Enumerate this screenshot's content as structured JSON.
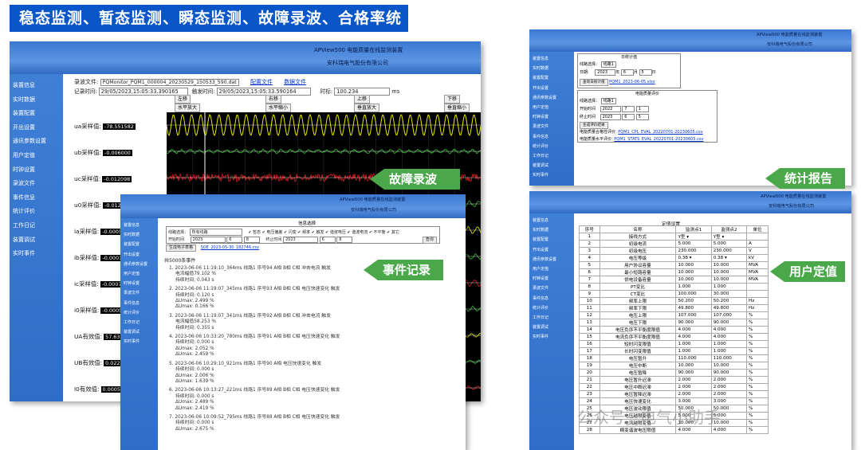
{
  "banner": "稳态监测、暂态监测、瞬态监测、故障录波、合格率统计等",
  "device_title": "APView500 电能质量在线监测装置",
  "company": "安科瑞电气股份有限公司",
  "menu": [
    "装置信息",
    "实时数据",
    "装置配置",
    "开出设置",
    "通讯参数设置",
    "用户定值",
    "时钟设置",
    "录波文件",
    "事件信息",
    "统计评价",
    "工作日记",
    "装置调试",
    "实时事件"
  ],
  "wave": {
    "file_label": "录波文件:",
    "file_value": "PQMonitor_PQM1_000004_20230529_150533_590.dat",
    "config_link": "配置文件",
    "data_link": "数据文件",
    "rec_time_label": "记录时间:",
    "rec_time": "29/05/2023,15:05:33.390165",
    "trig_time_label": "触发时间:",
    "trig_time": "29/05/2023,15:05:33.590164",
    "time_label": "时标:",
    "time_value": "100.234",
    "time_unit": "ms",
    "btn_left": "左移",
    "btn_right": "右移",
    "btn_up": "上移",
    "btn_down": "下移",
    "btn_hzoom_in": "水平放大",
    "btn_hzoom_out": "水平缩小",
    "btn_vzoom_in": "垂直放大",
    "btn_vzoom_out": "垂直缩小",
    "channels": [
      {
        "label": "ua采样值:",
        "value": "-78.551582"
      },
      {
        "label": "ub采样值:",
        "value": "-0.006000"
      },
      {
        "label": "uc采样值:",
        "value": "-0.012098"
      },
      {
        "label": "u0采样值:",
        "value": "-0.0129"
      },
      {
        "label": "ia采样值:",
        "value": "-0.00052"
      },
      {
        "label": "ib采样值:",
        "value": "-0.0001"
      },
      {
        "label": "ic采样值:",
        "value": "-0.00071"
      },
      {
        "label": "i0采样值:",
        "value": "-0.00052"
      },
      {
        "label": "UA有效值:",
        "value": "57.637"
      },
      {
        "label": "UB有效值:",
        "value": "0.022"
      },
      {
        "label": "I0有效值:",
        "value": "0.00052"
      }
    ],
    "tag": "故障录波"
  },
  "events": {
    "header": "信息选择",
    "line_label": "线路选择：",
    "line_value": "所有线路",
    "checks": "✔ 暂态 ✔ 电压偏差 ✔ 闪变 ✔ 频率 ✔ 触发 ✔ 谐波电压 ✔ 谐波电流 ✔ 不平衡 ✔ 其它",
    "start_label": "开始时间",
    "start_value": "2023",
    "end_label": "终止时间",
    "end_value": "2023",
    "month": "6",
    "day": "8",
    "query_btn": "查询",
    "export_btn": "生成电子表格",
    "export_file": "SOE_2023-05-30_182746.csv",
    "count": "共5000条事件",
    "items": [
      {
        "h": "1. 2023-06-06 11:19:10_364ms 线路1 序号94 A相 B相 C相  冲击电流 触发",
        "l": [
          "电流幅值79.102 %",
          "持续时间: 0.043 s"
        ]
      },
      {
        "h": "2. 2023-06-06 11:19:07_345ms 线路1 序号93 A相 B相 C相  电压快速变化 触发",
        "l": [
          "持续时间: 0.120 s",
          "ΔUmax: 2.499 %",
          "ΔUmax: 0.166 %"
        ]
      },
      {
        "h": "3. 2023-06-06 11:19:07_341ms 线路1 序号92 A相 B相 C相  冲击电流 触发",
        "l": [
          "电流幅值58.253 %",
          "持续时间: 0.355 s"
        ]
      },
      {
        "h": "4. 2023-06-06 10:33:20_780ms 线路1 序号91 A相 B相 C相  电压快速变化 触发",
        "l": [
          "持续时间: 0.000 s",
          "ΔUmax: 2.052 %",
          "ΔUmax: 2.459 %"
        ]
      },
      {
        "h": "5. 2023-06-06 10:29:10_921ms 线路1 序号90 A相  电压快速变化 触发",
        "l": [
          "持续时间: 0.000 s",
          "ΔUmax: 2.006 %",
          "ΔUmax: 1.639 %"
        ]
      },
      {
        "h": "6. 2023-06-06 10:13:27_221ms 线路1 序号89 A相 B相 C相  电压快速变化 触发",
        "l": [
          "持续时间: 0.000 s",
          "ΔUmax: 2.489 %",
          "ΔUmax: 2.419 %"
        ]
      },
      {
        "h": "7. 2023-06-06 10:09:52_795ms 线路1 序号88 A相 B相 C相  电压快速变化 触发",
        "l": [
          "持续时间: 0.000 s",
          "ΔUmax: 2.675 %"
        ]
      }
    ],
    "tag": "事件记录"
  },
  "stats": {
    "daily_title": "日统计值",
    "line_label": "线路选择：",
    "line_value": "线路1",
    "date_label": "日期:",
    "date_value": "2023",
    "month": "6",
    "day": "5",
    "day_unit": "日",
    "month_unit": "月",
    "year_unit": "年",
    "gen_btn": "查询日统计值",
    "daily_file": "PQM1_2023-06-05.xlsx",
    "eval_title": "电能质量评价",
    "start_label": "开始时间",
    "start_y": "2022",
    "start_m": "7",
    "start_d": "1",
    "end_label": "终止时间",
    "end_y": "2023",
    "end_m": "6",
    "end_d": "5",
    "gen_eval_btn": "生成评价结果",
    "eval1_label": "电能质量合格性评价:",
    "eval1_file": "PQM1_CPL_EVAL_20220701-20230605.csv",
    "eval2_label": "电能质量水平评价:",
    "eval2_file": "PQM1_STATS_EVAL_20220701-20230605.csv",
    "tag": "统计报告"
  },
  "settings": {
    "title": "定值设置",
    "headers": [
      "序号",
      "名称",
      "监测点1",
      "监测点2",
      "单位"
    ],
    "rows": [
      [
        "1",
        "接线方式",
        "Y型 ▾",
        "Y型 ▾",
        ""
      ],
      [
        "2",
        "初级电流",
        "5.000",
        "5.000",
        "A"
      ],
      [
        "3",
        "初级电压",
        "230.000",
        "230.000",
        "V"
      ],
      [
        "4",
        "电压等级",
        "0.38 ▾",
        "0.38 ▾",
        "kV"
      ],
      [
        "5",
        "用户协议容量",
        "10.000",
        "10.000",
        "MVA"
      ],
      [
        "6",
        "最小短路容量",
        "10.000",
        "10.000",
        "MVA"
      ],
      [
        "7",
        "供电设备容量",
        "10.000",
        "10.000",
        "MVA"
      ],
      [
        "8",
        "PT变比",
        "1.000",
        "1.000",
        ""
      ],
      [
        "9",
        "CT变比",
        "100.000",
        "30.000",
        ""
      ],
      [
        "10",
        "频率上限",
        "50.200",
        "50.200",
        "Hz"
      ],
      [
        "11",
        "频率下限",
        "49.800",
        "49.800",
        "Hz"
      ],
      [
        "12",
        "电压上限",
        "107.000",
        "107.000",
        "%"
      ],
      [
        "13",
        "电压下限",
        "90.000",
        "90.000",
        "%"
      ],
      [
        "14",
        "电压负序不平衡度限值",
        "4.000",
        "4.000",
        "%"
      ],
      [
        "15",
        "电流负序不平衡度限值",
        "4.000",
        "4.000",
        "%"
      ],
      [
        "16",
        "短时闪变限值",
        "1.000",
        "1.000",
        "%"
      ],
      [
        "17",
        "长时闪变限值",
        "1.000",
        "1.000",
        "%"
      ],
      [
        "18",
        "电压暂升",
        "110.000",
        "110.000",
        "%"
      ],
      [
        "19",
        "电压中断",
        "10.000",
        "10.000",
        "%"
      ],
      [
        "20",
        "电压暂降",
        "90.000",
        "90.000",
        "%"
      ],
      [
        "21",
        "电压暂升迟滞",
        "2.000",
        "2.000",
        "%"
      ],
      [
        "22",
        "电压中断迟滞",
        "2.000",
        "2.000",
        "%"
      ],
      [
        "23",
        "电压暂降迟滞",
        "2.000",
        "2.000",
        "%"
      ],
      [
        "24",
        "电压快速变化",
        "3.000",
        "3.000",
        "%"
      ],
      [
        "25",
        "电压波动限值",
        "50.000",
        "50.000",
        "%"
      ],
      [
        "26",
        "电压越限变值",
        "5.000",
        "5.000",
        "%"
      ],
      [
        "27",
        "电流越限变值",
        "10.000",
        "10.000",
        "%"
      ],
      [
        "28",
        "畸变谐波电压限值",
        "4.000",
        "4.000",
        "%"
      ]
    ],
    "tag": "用户定值"
  },
  "watermark": "公众号 · 电气小助手",
  "colors": {
    "banner": "#0a56c8",
    "tag": "#4aa84a",
    "sidebar": "#3f7fd6",
    "wave_bg": "#000000",
    "wave_yellow": "#e8e800",
    "wave_green": "#2fbf2f",
    "wave_red": "#e02020"
  }
}
